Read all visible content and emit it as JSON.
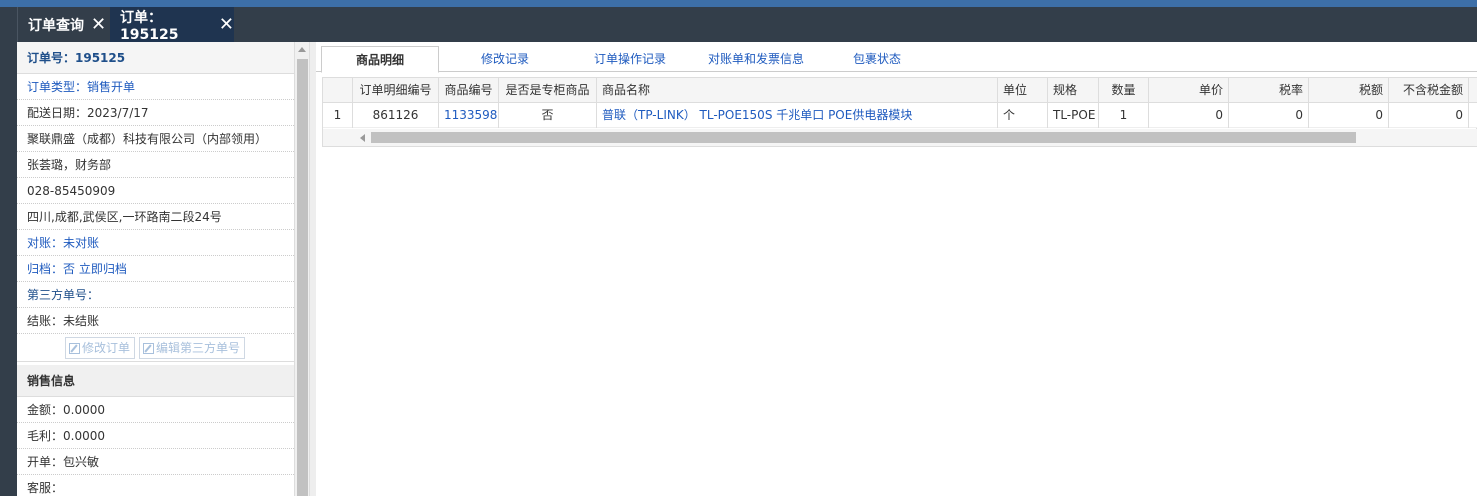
{
  "tabs": [
    {
      "label": "订单查询",
      "close": "✕"
    },
    {
      "label": "订单：195125",
      "close": "✕"
    }
  ],
  "order": {
    "header": "订单号：195125",
    "type": "订单类型：销售开单",
    "delivery_date": "配送日期：2023/7/17",
    "company": "聚联鼎盛（成都）科技有限公司（内部领用）",
    "contact": "张荟璐，财务部",
    "phone": "028-85450909",
    "address": "四川,成都,武侯区,一环路南二段24号",
    "reconcile": "对账：未对账",
    "archive_label": "归档：",
    "archive_value": "否 立即归档",
    "third_party": "第三方单号：",
    "settle": "结账：未结账",
    "edit_order_button": "修改订单",
    "edit_third_party_button": "编辑第三方单号"
  },
  "sales": {
    "section_title": "销售信息",
    "amount": "金额：0.0000",
    "gross_profit": "毛利：0.0000",
    "issuer": "开单：包兴敏",
    "service": "客服："
  },
  "main_tabs": [
    "商品明细",
    "修改记录",
    "订单操作记录",
    "对账单和发票信息",
    "包裹状态"
  ],
  "grid": {
    "columns": [
      "订单明细编号",
      "商品编号",
      "是否是专柜商品",
      "商品名称",
      "单位",
      "规格",
      "数量",
      "单价",
      "税率",
      "税额",
      "不含税金额"
    ],
    "rows": [
      {
        "index": "1",
        "detail_no": "861126",
        "product_no": "1133598",
        "counter": "否",
        "name": "普联（TP-LINK） TL-POE150S 千兆单口 POE供电器模块",
        "unit": "个",
        "spec": "TL-POE",
        "qty": "1",
        "price": "0",
        "tax_rate": "0",
        "tax": "0",
        "amount_ex_tax": "0"
      }
    ]
  }
}
